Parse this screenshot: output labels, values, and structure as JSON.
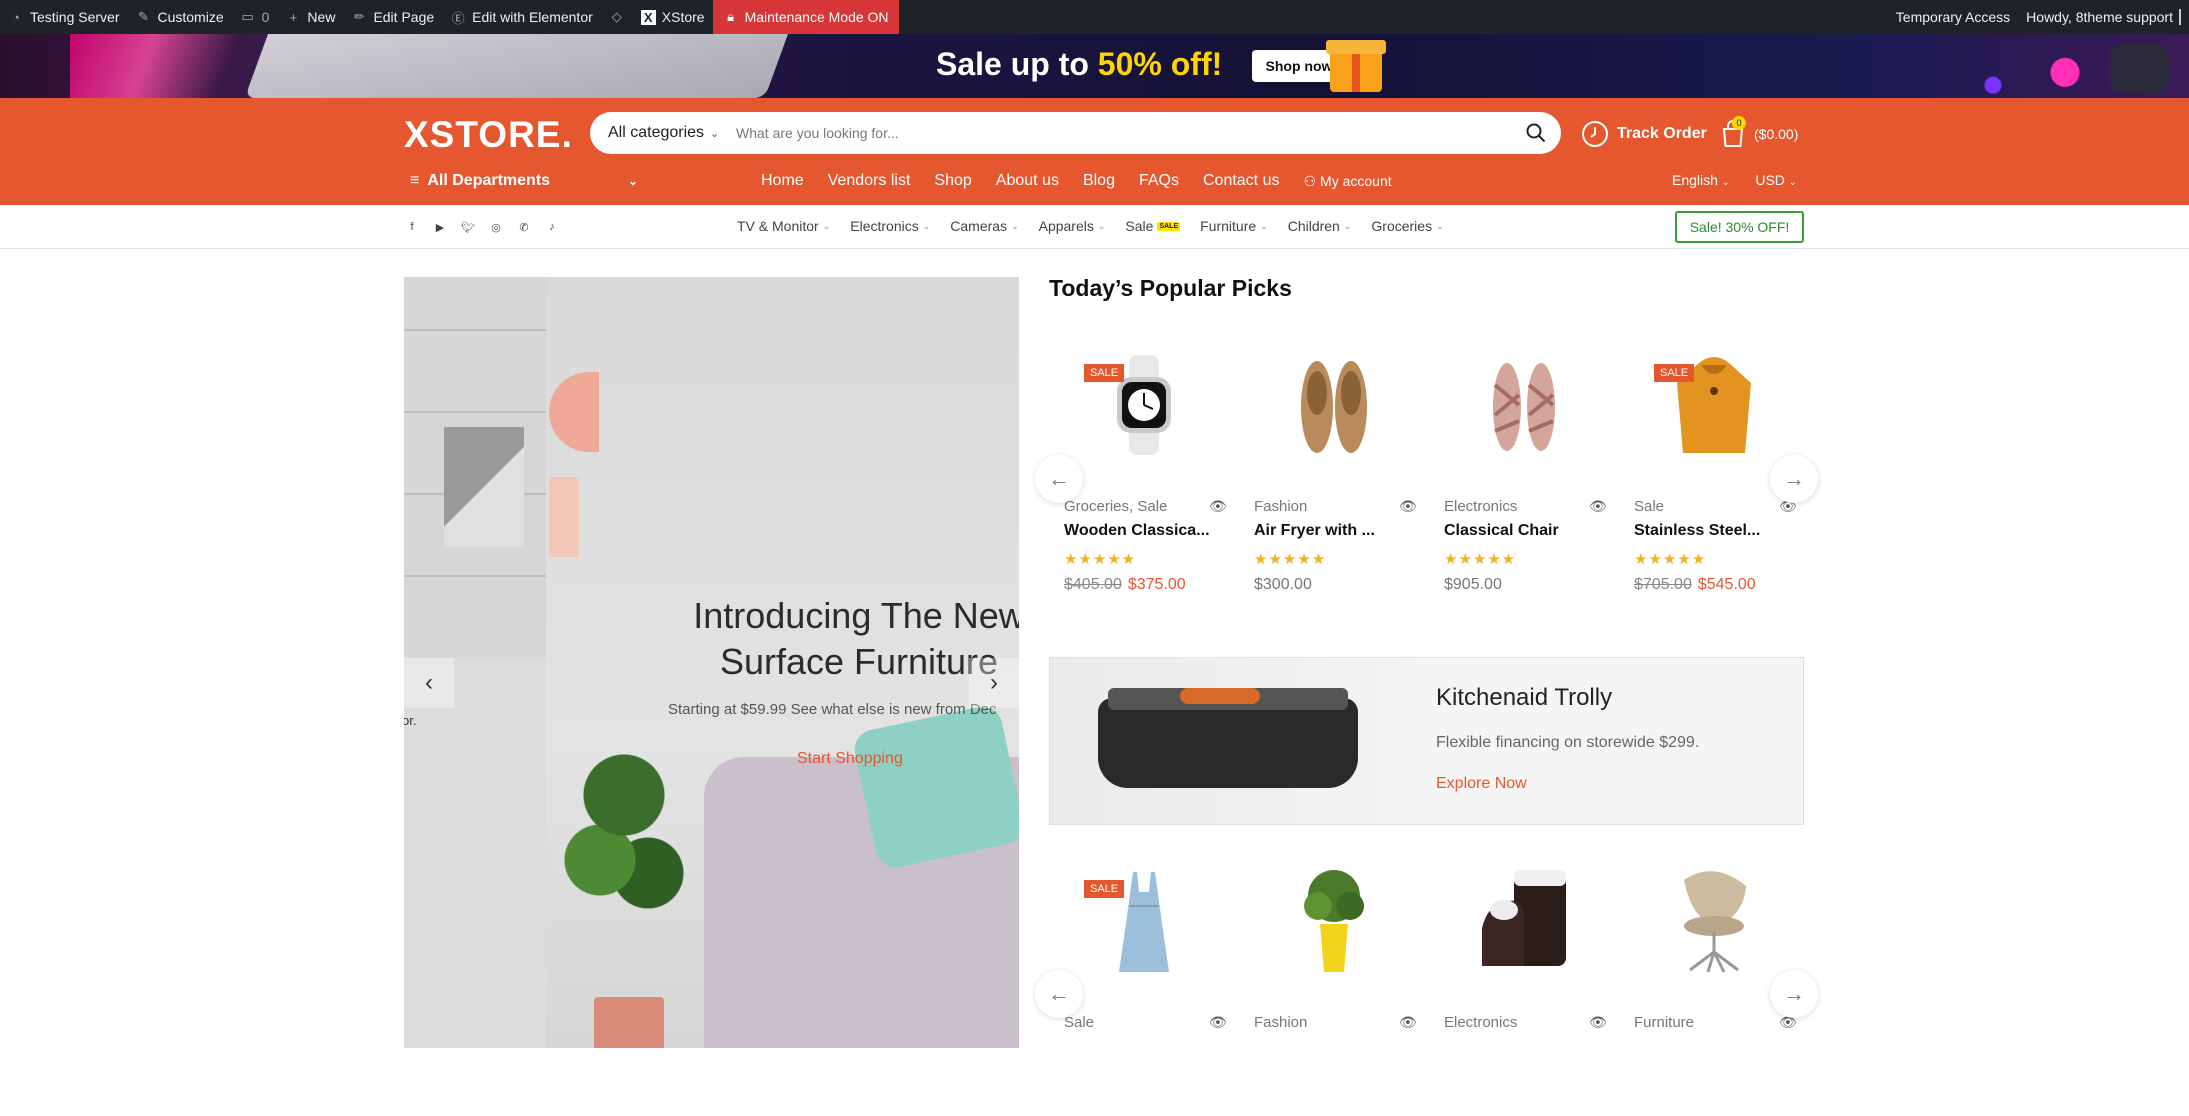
{
  "adminbar": {
    "site": "Testing Server",
    "customize": "Customize",
    "comments": "0",
    "new": "New",
    "edit_page": "Edit Page",
    "elementor": "Edit with Elementor",
    "xstore": "XStore",
    "maintenance": "Maintenance Mode ON",
    "temp_access": "Temporary Access",
    "howdy": "Howdy, 8theme support"
  },
  "promo": {
    "text_prefix": "Sale up to ",
    "text_highlight": "50% off!",
    "button": "Shop now"
  },
  "header": {
    "logo": "XSTORE.",
    "search_category": "All categories",
    "search_placeholder": "What are you looking for...",
    "track_order": "Track Order",
    "cart_count": "0",
    "cart_total": "($0.00)"
  },
  "nav": {
    "all_departments": "All Departments",
    "items": [
      "Home",
      "Vendors list",
      "Shop",
      "About us",
      "Blog",
      "FAQs",
      "Contact us"
    ],
    "my_account": "My account",
    "language": "English",
    "currency": "USD"
  },
  "subnav": {
    "categories": [
      "TV & Monitor",
      "Electronics",
      "Cameras",
      "Apparels",
      "Sale",
      "Furniture",
      "Children",
      "Groceries"
    ],
    "sale_tag": "SALE",
    "sale_button": "Sale! 30% OFF!"
  },
  "hero": {
    "title_line1": "Introducing The New",
    "title_line2": "Surface Furniture",
    "subtitle": "Starting at $59.99 See what else is new from Dec",
    "cta": "Start Shopping",
    "left_fragment": "or."
  },
  "popular": {
    "title": "Today’s Popular Picks",
    "row1": [
      {
        "sale_label": "SALE",
        "category": "Groceries, Sale",
        "name": "Wooden Classica...",
        "old_price": "$405.00",
        "price": "$375.00",
        "icon": "watch"
      },
      {
        "sale_label": "",
        "category": "Fashion",
        "name": "Air Fryer with ...",
        "old_price": "",
        "price": "$300.00",
        "icon": "shoes"
      },
      {
        "sale_label": "",
        "category": "Electronics",
        "name": "Classical Chair",
        "old_price": "",
        "price": "$905.00",
        "icon": "sandals"
      },
      {
        "sale_label": "SALE",
        "category": "Sale",
        "name": "Stainless Steel...",
        "old_price": "$705.00",
        "price": "$545.00",
        "icon": "hoodie"
      }
    ],
    "row2": [
      {
        "sale_label": "SALE",
        "category": "Sale",
        "icon": "dress"
      },
      {
        "sale_label": "",
        "category": "Fashion",
        "icon": "plant"
      },
      {
        "sale_label": "",
        "category": "Electronics",
        "icon": "vase"
      },
      {
        "sale_label": "",
        "category": "Furniture",
        "icon": "chair"
      }
    ]
  },
  "kitchen_card": {
    "title": "Kitchenaid Trolly",
    "subtitle": "Flexible financing on storewide $299.",
    "link": "Explore Now"
  },
  "colors": {
    "brand": "#e5572f",
    "adminbar": "#1d2327",
    "maintenance": "#d63638",
    "stars": "#f6b01e",
    "sale_button_border": "#3a9b3a"
  }
}
